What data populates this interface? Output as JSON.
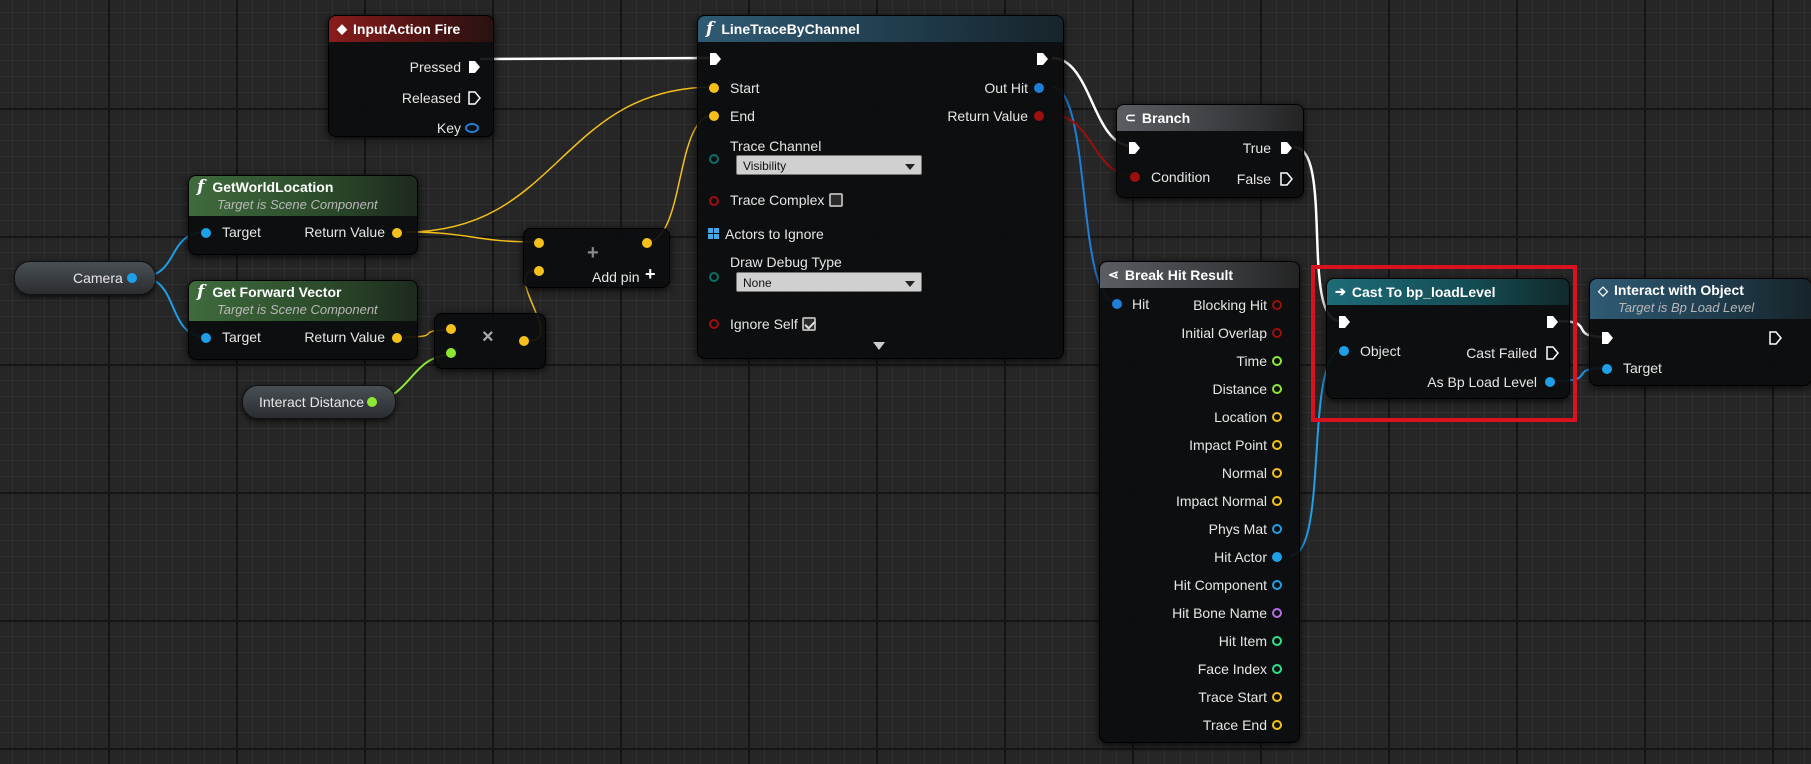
{
  "colors": {
    "exec": "#ffffff",
    "object": "#1e9fe8",
    "vector": "#f5c01c",
    "float": "#8de834",
    "bool": "#9c0f0f",
    "byte": "#0a6f68",
    "struct": "#1f7fd8",
    "name": "#b56ce8",
    "int": "#2ee08a",
    "highlight": "#d8121f"
  },
  "input_action": {
    "title": "InputAction Fire",
    "icon": "event-diamond-icon",
    "pressed": "Pressed",
    "released": "Released",
    "key": "Key"
  },
  "line_trace": {
    "title": "LineTraceByChannel",
    "icon": "function-icon",
    "start": "Start",
    "end": "End",
    "trace_channel": "Trace Channel",
    "trace_channel_value": "Visibility",
    "trace_complex": "Trace Complex",
    "trace_complex_checked": false,
    "actors_to_ignore": "Actors to Ignore",
    "draw_debug_type": "Draw Debug Type",
    "draw_debug_value": "None",
    "ignore_self": "Ignore Self",
    "ignore_self_checked": true,
    "out_hit": "Out Hit",
    "return_value": "Return Value"
  },
  "get_world_location": {
    "title": "GetWorldLocation",
    "subtitle": "Target is Scene Component",
    "target": "Target",
    "return_value": "Return Value"
  },
  "get_forward_vector": {
    "title": "Get Forward Vector",
    "subtitle": "Target is Scene Component",
    "target": "Target",
    "return_value": "Return Value"
  },
  "camera": {
    "label": "Camera"
  },
  "interact_distance": {
    "label": "Interact Distance"
  },
  "add_node": {
    "add_pin": "Add pin",
    "symbol": "+"
  },
  "multiply_node": {
    "symbol": "×"
  },
  "branch": {
    "title": "Branch",
    "condition": "Condition",
    "true": "True",
    "false": "False"
  },
  "break_hit_result": {
    "title": "Break Hit Result",
    "hit": "Hit",
    "outputs": [
      {
        "label": "Blocking Hit",
        "type": "bool"
      },
      {
        "label": "Initial Overlap",
        "type": "bool"
      },
      {
        "label": "Time",
        "type": "float"
      },
      {
        "label": "Distance",
        "type": "float"
      },
      {
        "label": "Location",
        "type": "vector"
      },
      {
        "label": "Impact Point",
        "type": "vector"
      },
      {
        "label": "Normal",
        "type": "vector"
      },
      {
        "label": "Impact Normal",
        "type": "vector"
      },
      {
        "label": "Phys Mat",
        "type": "object"
      },
      {
        "label": "Hit Actor",
        "type": "object"
      },
      {
        "label": "Hit Component",
        "type": "object"
      },
      {
        "label": "Hit Bone Name",
        "type": "name"
      },
      {
        "label": "Hit Item",
        "type": "int"
      },
      {
        "label": "Face Index",
        "type": "int"
      },
      {
        "label": "Trace Start",
        "type": "vector"
      },
      {
        "label": "Trace End",
        "type": "vector"
      }
    ]
  },
  "cast": {
    "title": "Cast To bp_loadLevel",
    "icon": "cast-arrows-icon",
    "object": "Object",
    "cast_failed": "Cast Failed",
    "as_output": "As Bp Load Level"
  },
  "interact": {
    "title": "Interact with Object",
    "subtitle": "Target is Bp Load Level",
    "target": "Target"
  }
}
